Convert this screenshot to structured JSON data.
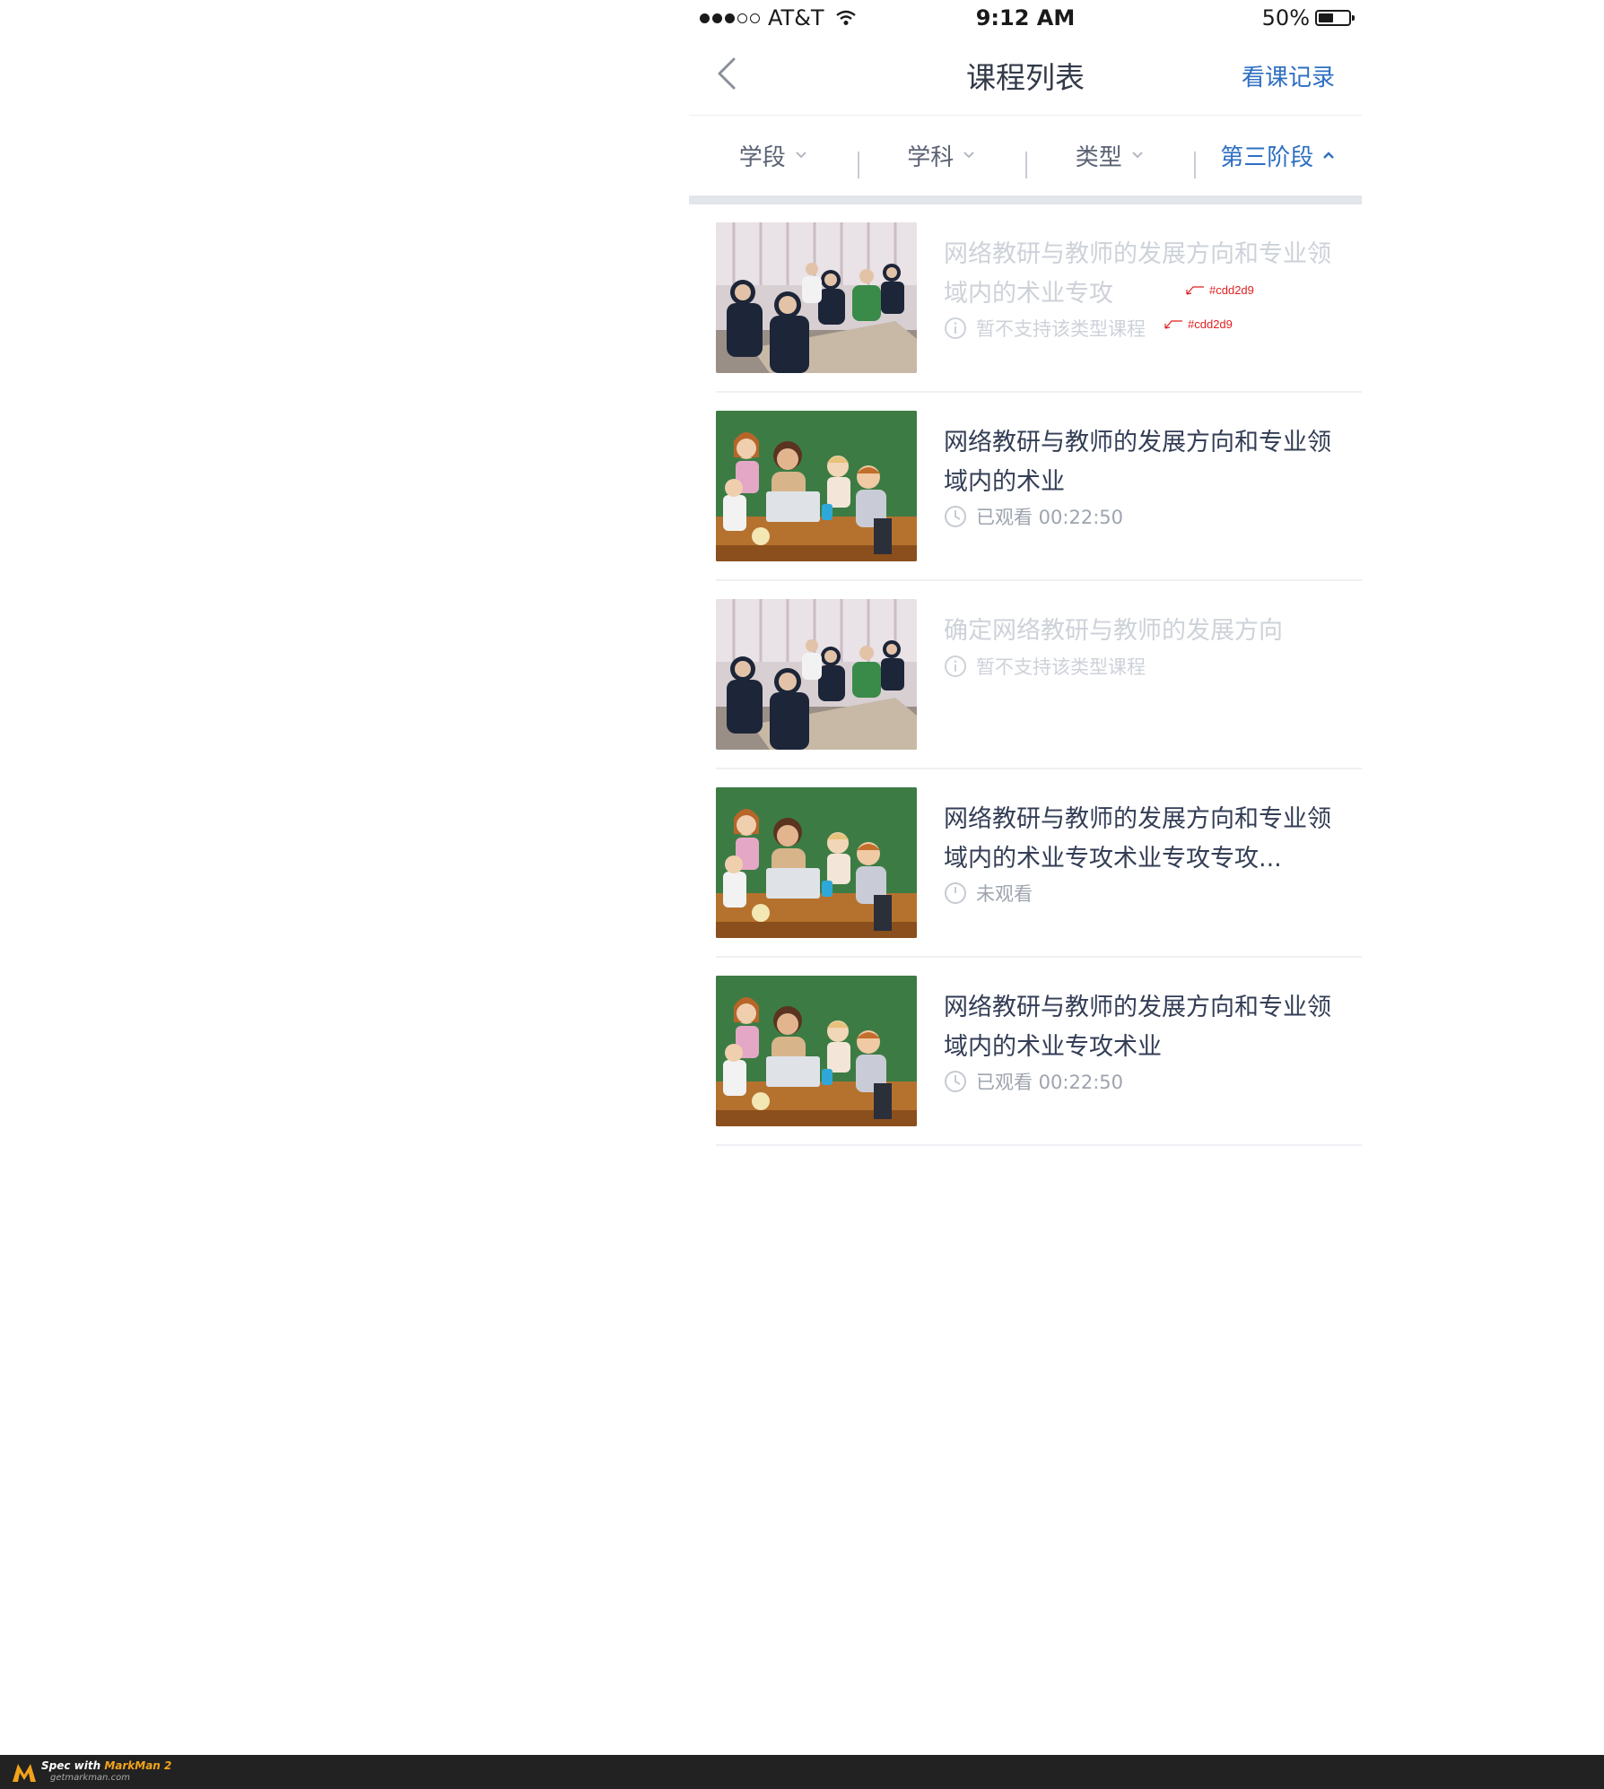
{
  "status_bar": {
    "carrier": "AT&T",
    "time": "9:12 AM",
    "battery_text": "50%",
    "battery_level": 0.5
  },
  "nav": {
    "title": "课程列表",
    "right_label": "看课记录"
  },
  "filters": [
    {
      "label": "学段",
      "active": false
    },
    {
      "label": "学科",
      "active": false
    },
    {
      "label": "类型",
      "active": false
    },
    {
      "label": "第三阶段",
      "active": true
    }
  ],
  "courses": [
    {
      "title": "网络教研与教师的发展方向和专业领域内的术业专攻",
      "meta": "暂不支持该类型课程",
      "meta_icon": "info-icon",
      "disabled": true,
      "image": "classroom-students"
    },
    {
      "title": "网络教研与教师的发展方向和专业领域内的术业",
      "meta": "已观看 00:22:50",
      "meta_icon": "clock-icon",
      "disabled": false,
      "image": "teacher-kids-chalkboard"
    },
    {
      "title": "确定网络教研与教师的发展方向",
      "meta": "暂不支持该类型课程",
      "meta_icon": "info-icon",
      "disabled": true,
      "image": "classroom-students"
    },
    {
      "title": "网络教研与教师的发展方向和专业领域内的术业专攻术业专攻专攻...",
      "meta": "未观看",
      "meta_icon": "clock-icon",
      "disabled": false,
      "image": "teacher-kids-chalkboard"
    },
    {
      "title": "网络教研与教师的发展方向和专业领域内的术业专攻术业",
      "meta": "已观看 00:22:50",
      "meta_icon": "clock-icon",
      "disabled": false,
      "image": "teacher-kids-chalkboard"
    }
  ],
  "annotations": {
    "title_color": "#cdd2d9",
    "meta_color": "#cdd2d9"
  },
  "colors": {
    "accent": "#2d6fc2",
    "title": "#333d55",
    "disabled": "#cdd2d9",
    "meta": "#9ea4ae",
    "divider": "#e2e5ea"
  },
  "footer": {
    "brand": "Spec with ",
    "brand_app": "MarkMan 2",
    "site": "getmarkman.com"
  }
}
